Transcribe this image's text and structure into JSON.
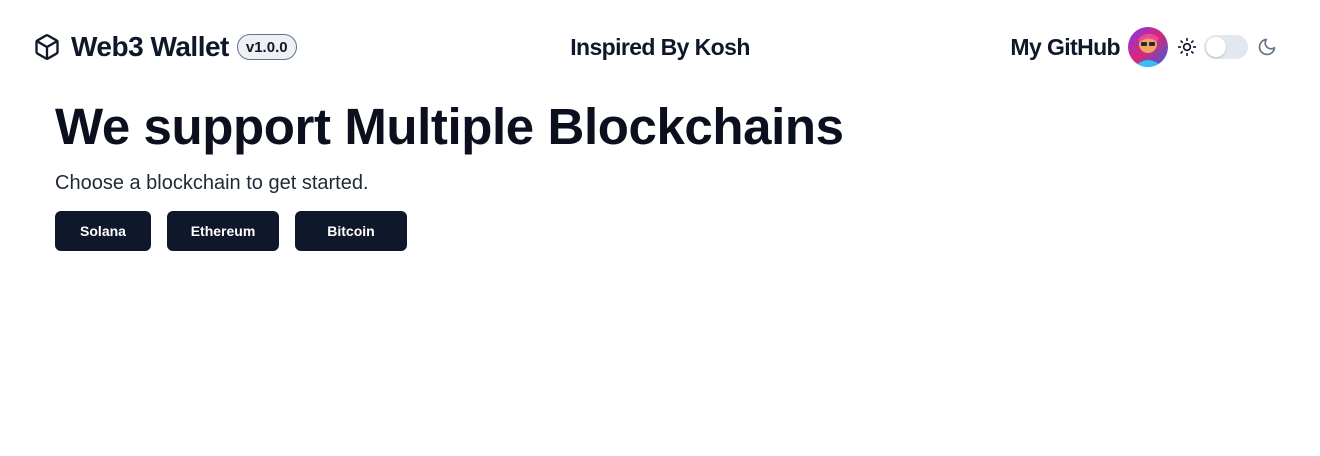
{
  "header": {
    "app_title": "Web3 Wallet",
    "version": "v1.0.0",
    "tagline": "Inspired By Kosh",
    "github_label": "My GitHub"
  },
  "theme": {
    "light_icon": "sun-icon",
    "dark_icon": "moon-icon",
    "mode": "light"
  },
  "main": {
    "headline": "We support Multiple Blockchains",
    "subtitle": "Choose a blockchain to get started.",
    "chains": [
      "Solana",
      "Ethereum",
      "Bitcoin"
    ]
  },
  "colors": {
    "primary_button": "#0f172a",
    "text": "#0f172a",
    "toggle_track": "#e2e8f0"
  }
}
